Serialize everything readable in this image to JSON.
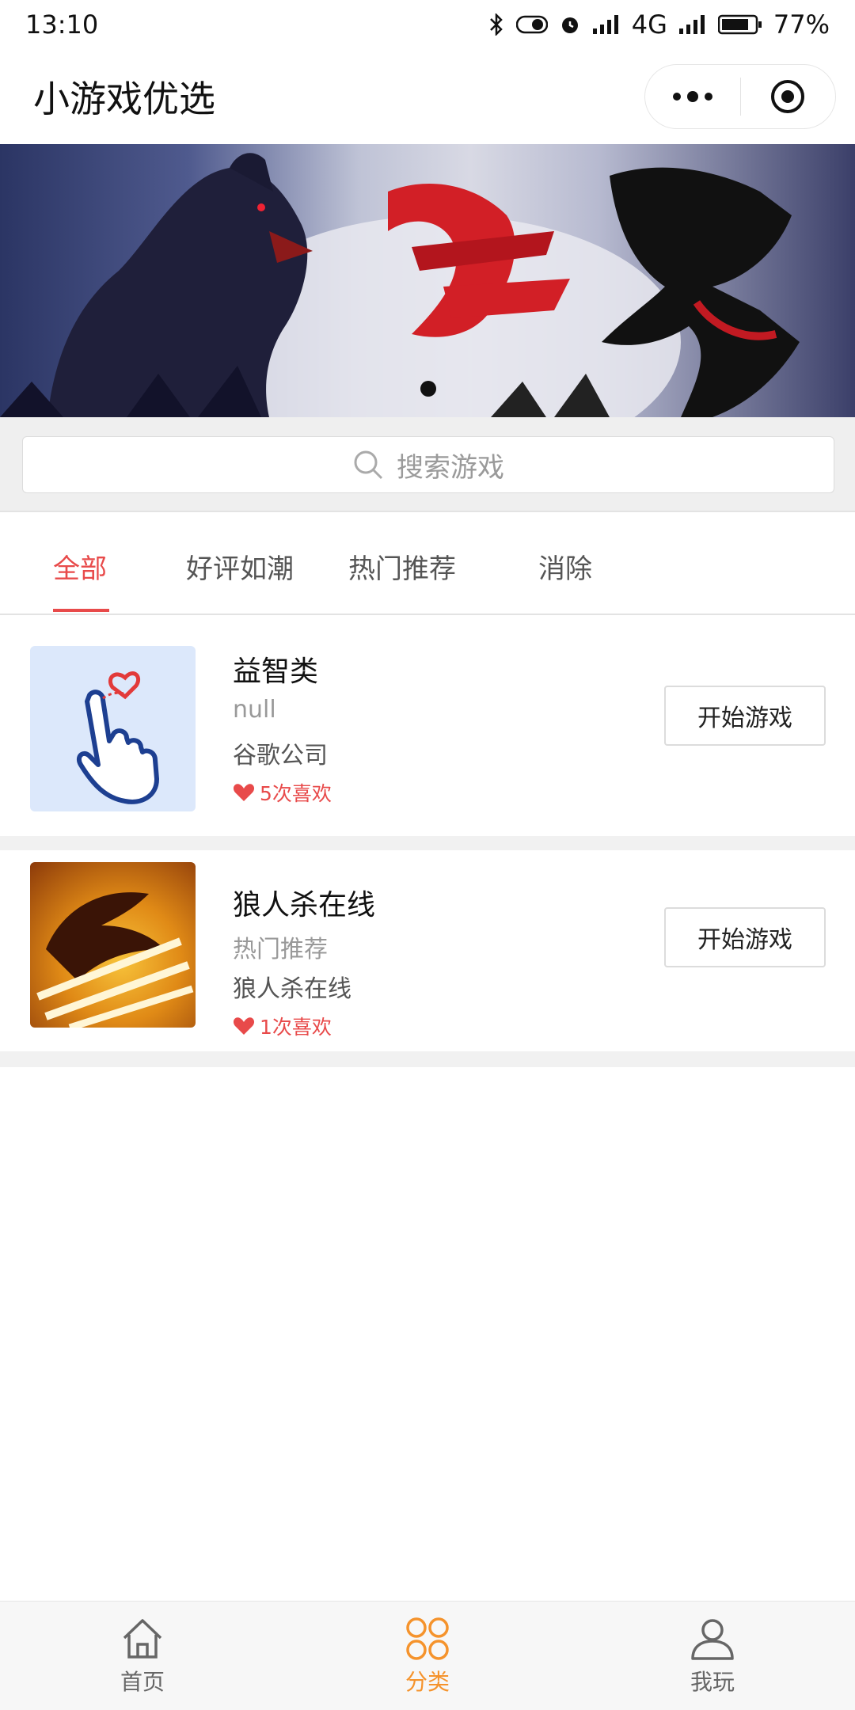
{
  "status_bar": {
    "time": "13:10",
    "network": "4G",
    "battery": "77%"
  },
  "header": {
    "title": "小游戏优选"
  },
  "search": {
    "placeholder": "搜索游戏"
  },
  "tabs": [
    {
      "label": "全部",
      "active": true
    },
    {
      "label": "好评如潮",
      "active": false
    },
    {
      "label": "热门推荐",
      "active": false
    },
    {
      "label": "消除",
      "active": false
    }
  ],
  "games": [
    {
      "name": "益智类",
      "category": "null",
      "developer": "谷歌公司",
      "likes": "5次喜欢",
      "button": "开始游戏"
    },
    {
      "name": "狼人杀在线",
      "category": "热门推荐",
      "developer": "狼人杀在线",
      "likes": "1次喜欢",
      "button": "开始游戏"
    }
  ],
  "bottom_nav": [
    {
      "label": "首页",
      "icon": "home-icon",
      "active": false
    },
    {
      "label": "分类",
      "icon": "category-icon",
      "active": true
    },
    {
      "label": "我玩",
      "icon": "user-icon",
      "active": false
    }
  ],
  "colors": {
    "accent_red": "#e84a4a",
    "nav_active_orange": "#f5932c",
    "thumb_bg_blue": "#dce8fb"
  }
}
